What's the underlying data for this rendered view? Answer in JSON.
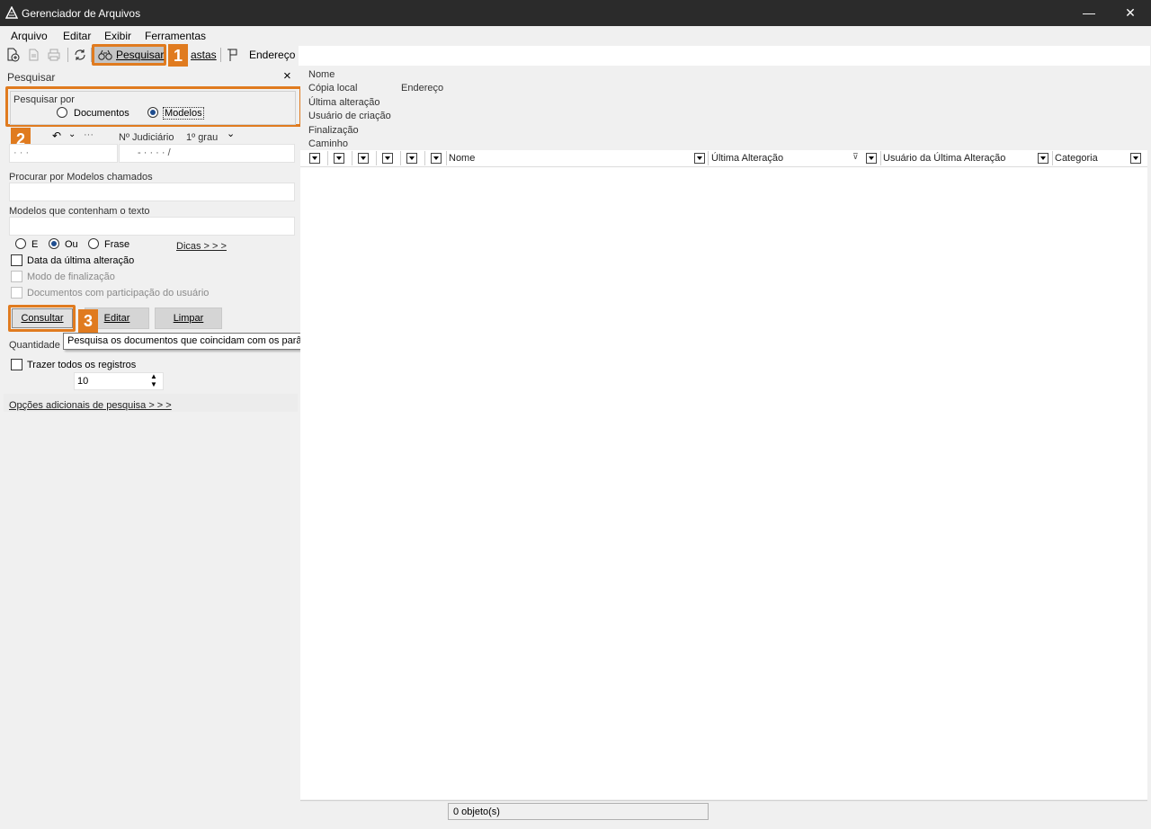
{
  "window": {
    "title": "Gerenciador de Arquivos",
    "minimize": "—",
    "close": "✕"
  },
  "menu": [
    "Arquivo",
    "Editar",
    "Exibir",
    "Ferramentas"
  ],
  "toolbar": {
    "search_label": "Pesquisar",
    "folders_label": "astas",
    "address_label": "Endereço"
  },
  "left": {
    "panel_title": "Pesquisar",
    "close": "×",
    "search_by": {
      "label": "Pesquisar por",
      "options": [
        "Documentos",
        "Modelos"
      ],
      "selected": "Modelos"
    },
    "judicial": {
      "label": "Nº Judiciário",
      "grade": "1º grau",
      "value_left": "· ·   ·",
      "value_right": "- ·  · · ·    /"
    },
    "name_label": "Procurar por Modelos chamados",
    "name_value": "",
    "text_label": "Modelos que contenham o texto",
    "text_value": "",
    "logic": {
      "options": [
        "E",
        "Ou",
        "Frase"
      ],
      "selected": "Ou"
    },
    "tips_link": "Dicas > > >",
    "checks": [
      {
        "label": "Data da última alteração",
        "checked": false,
        "enabled": true
      },
      {
        "label": "Modo de finalização",
        "checked": false,
        "enabled": false
      },
      {
        "label": "Documentos com participação do usuário",
        "checked": false,
        "enabled": false
      }
    ],
    "buttons": {
      "consult": "Consultar",
      "edit": "Editar",
      "clear": "Limpar"
    },
    "quantity_label": "Quantidade",
    "bring_all_label": "Trazer todos os registros",
    "quantity_value": "10",
    "more_options_link": "Opções adicionais de pesquisa > > >"
  },
  "tooltip": "Pesquisa os documentos que coincidam com os parâmetros informados.",
  "badges": [
    "1",
    "2",
    "3"
  ],
  "right": {
    "info": {
      "nome": "Nome",
      "copia_local": "Cópia local",
      "endereco": "Endereço",
      "ultima_alteracao": "Última alteração",
      "usuario_criacao": "Usuário de criação",
      "finalizacao": "Finalização",
      "caminho": "Caminho"
    },
    "columns": [
      "Nome",
      "Última Alteração",
      "Usuário da Última Alteração",
      "Categoria"
    ],
    "status": "0 objeto(s)"
  },
  "colors": {
    "accent": "#e07b1f",
    "titlebar": "#2b2b2b"
  }
}
